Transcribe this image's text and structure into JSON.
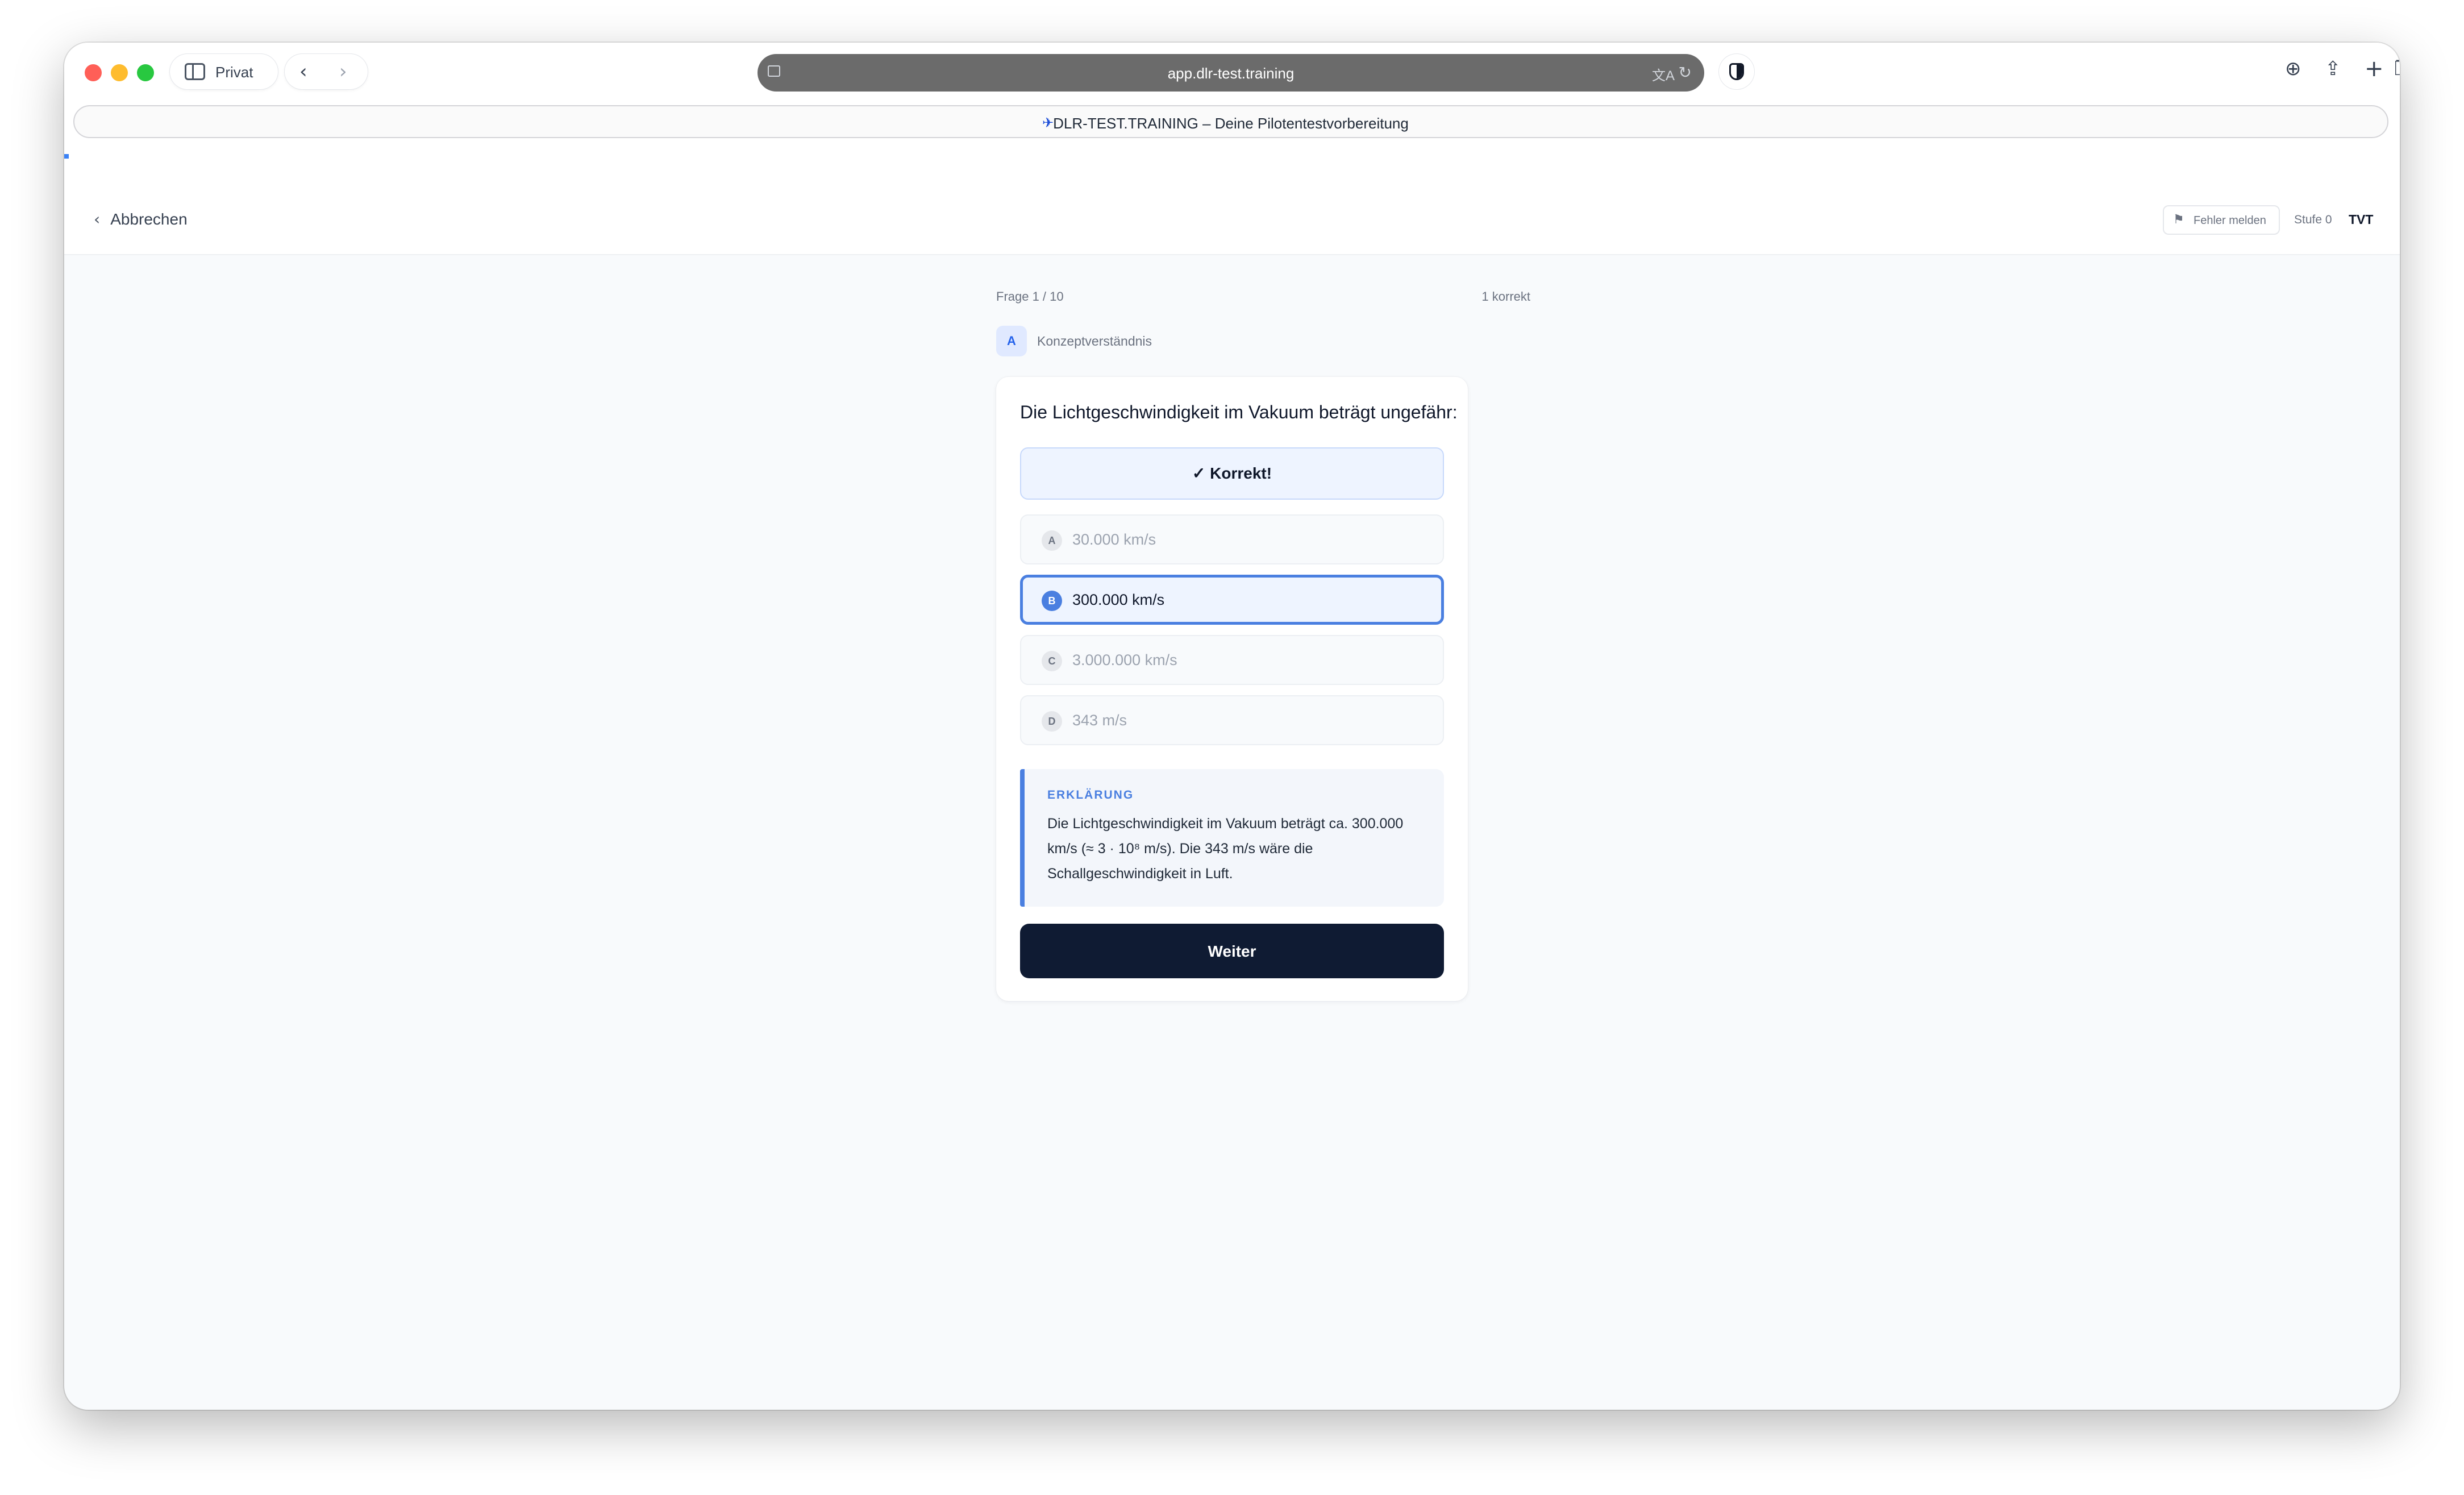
{
  "browser": {
    "sidebar_label": "Privat",
    "url": "app.dlr-test.training",
    "tab_title": "DLR-TEST.TRAINING – Deine Pilotentestvorbereitung"
  },
  "header": {
    "cancel_label": "Abbrechen",
    "report_label": "Fehler melden",
    "level_label": "Stufe 0",
    "test_label": "TVT",
    "progress_fraction": 0.0
  },
  "quiz": {
    "counter": "Frage 1 / 10",
    "score": "1 korrekt",
    "category_badge": "A",
    "category": "Konzeptverständnis",
    "question": "Die Lichtgeschwindigkeit im Vakuum beträgt ungefähr:",
    "feedback": "✓ Korrekt!",
    "options": [
      {
        "letter": "A",
        "text": "30.000 km/s"
      },
      {
        "letter": "B",
        "text": "300.000 km/s"
      },
      {
        "letter": "C",
        "text": "3.000.000 km/s"
      },
      {
        "letter": "D",
        "text": "343 m/s"
      }
    ],
    "selected_option": "B",
    "explanation_heading": "ERKLÄRUNG",
    "explanation": "Die Lichtgeschwindigkeit im Vakuum beträgt ca. 300.000 km/s (≈ 3 · 10⁸ m/s). Die 343 m/s wäre die Schallgeschwindigkeit in Luft.",
    "next_label": "Weiter"
  },
  "colors": {
    "accent": "#4a7fe0",
    "primary_button": "#0f1b33",
    "page_background": "#f8fafc"
  }
}
